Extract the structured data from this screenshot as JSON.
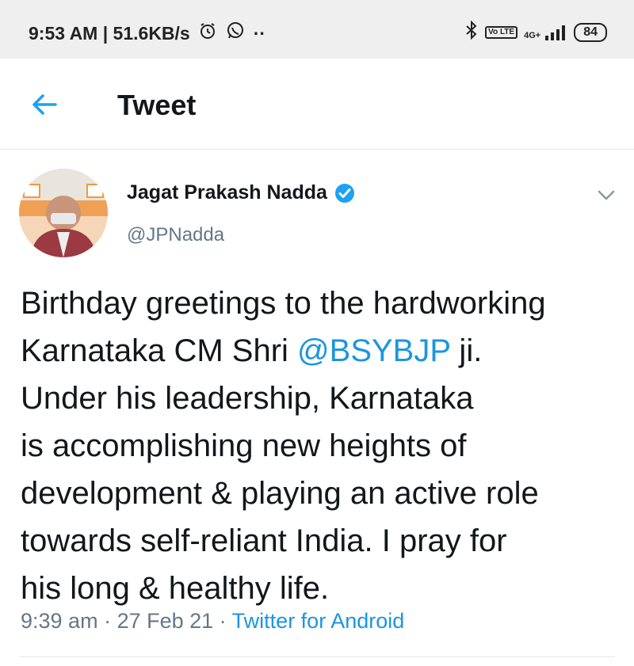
{
  "status_bar": {
    "time_speed": "9:53 AM | 51.6KB/s",
    "more": "··",
    "volte": "Vo LTE",
    "network": "4G+",
    "battery": "84"
  },
  "app_bar": {
    "title": "Tweet"
  },
  "tweet": {
    "author_name": "Jagat Prakash Nadda",
    "handle": "@JPNadda",
    "text_lines": [
      "Birthday greetings to the hardworking",
      "Karnataka CM Shri ",
      "@BSYBJP",
      " ji.",
      "Under his leadership, Karnataka",
      "is accomplishing new heights of",
      "development & playing an active role",
      "towards self-reliant India. I pray for",
      "his long & healthy life."
    ],
    "time": "9:39 am",
    "separator": " · ",
    "date": "27 Feb 21",
    "source": "Twitter for Android"
  },
  "colors": {
    "link": "#1b95e0",
    "secondary_text": "#657786",
    "verified": "#1da1f2"
  }
}
